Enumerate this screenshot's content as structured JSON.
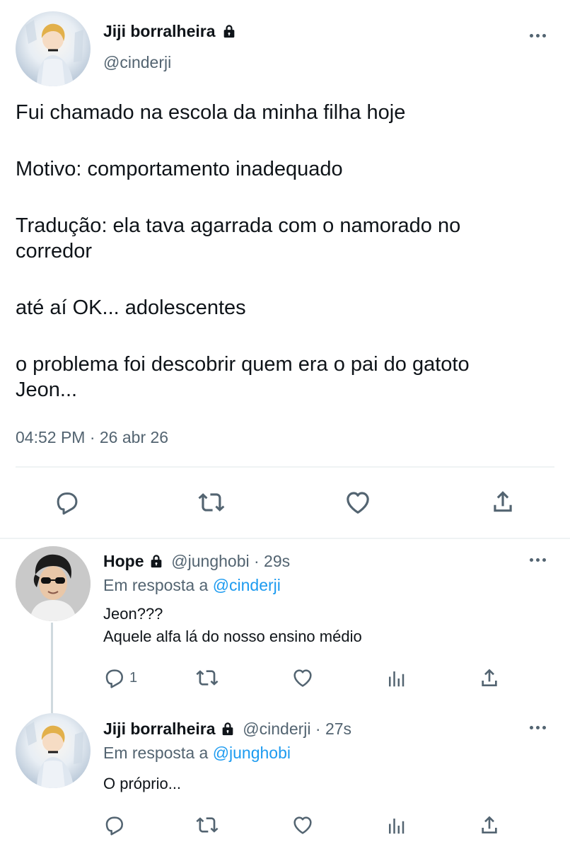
{
  "main_tweet": {
    "author_name": "Jiji borralheira",
    "handle": "@cinderji",
    "lines": [
      "Fui chamado na escola da minha filha hoje",
      "Motivo: comportamento inadequado",
      "Tradução: ela tava agarrada com o namorado no",
      "corredor",
      "até aí OK... adolescentes",
      "o problema foi descobrir quem era o pai do gatoto",
      "Jeon..."
    ],
    "timestamp": "04:52 PM · 26 abr 26"
  },
  "replies": [
    {
      "author_name": "Hope",
      "handle": "@junghobi",
      "time": "· 29s",
      "replying_prefix": "Em resposta a",
      "replying_to": "@cinderji",
      "lines": [
        "Jeon???",
        "Aquele alfa lá do nosso ensino médio"
      ],
      "reply_count": "1"
    },
    {
      "author_name": "Jiji borralheira",
      "handle": "@cinderji",
      "time": "· 27s",
      "replying_prefix": "Em resposta a",
      "replying_to": "@junghobi",
      "lines": [
        "O próprio..."
      ]
    }
  ],
  "icons": {
    "reply": "reply-icon",
    "retweet": "retweet-icon",
    "like": "like-icon",
    "share": "share-icon",
    "views": "views-icon",
    "lock": "lock-icon",
    "more": "more-icon"
  },
  "colors": {
    "text": "#0f1419",
    "muted": "#536471",
    "link": "#1d9bf0",
    "divider": "#eff3f4"
  }
}
